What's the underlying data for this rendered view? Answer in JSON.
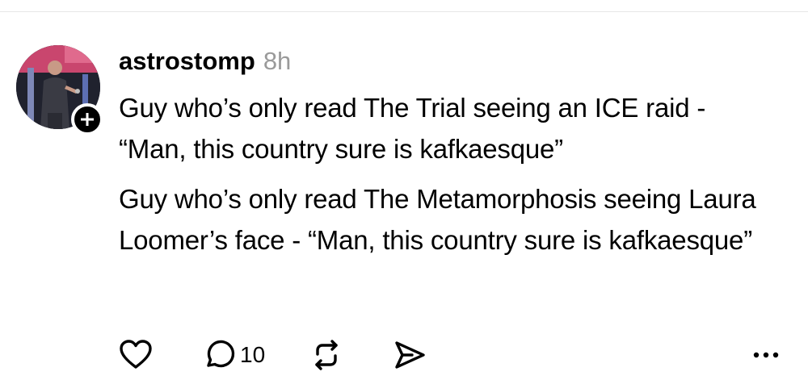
{
  "post": {
    "author": "astrostomp",
    "timestamp": "8h",
    "paragraphs": [
      "Guy who’s only read The Trial seeing an ICE raid - “Man, this country sure is kafkaesque”",
      "Guy who’s only read The Metamorphosis seeing Laura Loomer’s face - “Man, this country sure is kafkaesque”"
    ]
  },
  "actions": {
    "like_icon": "heart-icon",
    "reply_icon": "speech-bubble-icon",
    "reply_count": "10",
    "repost_icon": "repost-icon",
    "share_icon": "send-icon",
    "more_icon": "more-horizontal-icon"
  },
  "colors": {
    "text": "#000000",
    "muted": "#9a9a9a",
    "divider": "#e6e6e6",
    "badge": "#000000"
  }
}
